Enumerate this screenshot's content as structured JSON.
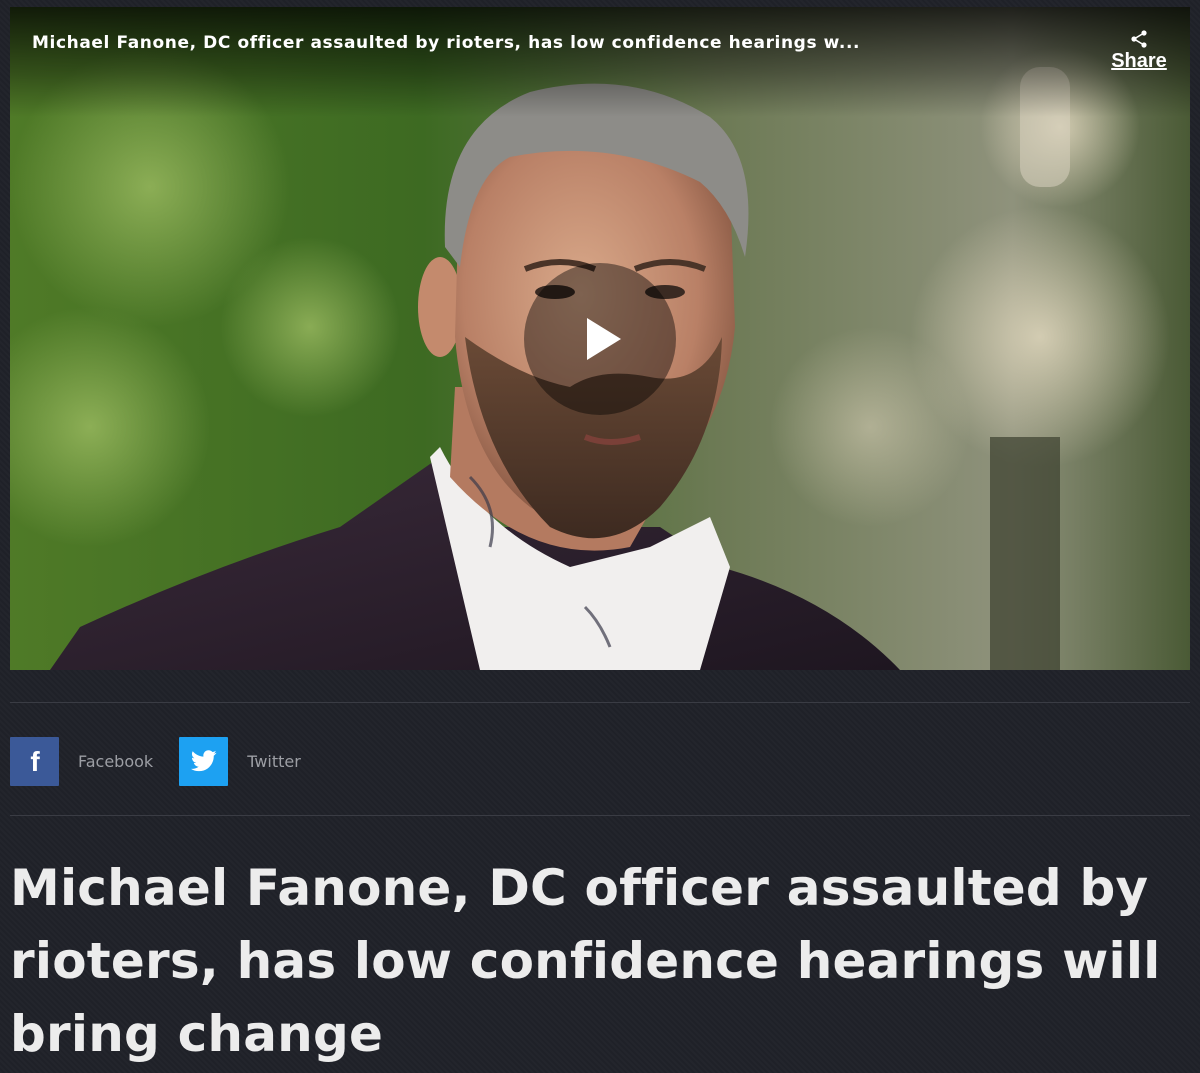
{
  "video": {
    "title": "Michael Fanone, DC officer assaulted by rioters, has low confidence hearings w...",
    "share_label": "Share",
    "share_icon": "share-icon",
    "play_icon": "play-icon"
  },
  "social": {
    "facebook": {
      "label": "Facebook",
      "icon": "facebook-icon",
      "color": "#3b5998"
    },
    "twitter": {
      "label": "Twitter",
      "icon": "twitter-icon",
      "color": "#1da1f2"
    }
  },
  "article": {
    "headline": "Michael Fanone, DC officer assaulted by rioters, has low confidence hearings will bring change"
  },
  "colors": {
    "background": "#1f2128",
    "text": "#ececec",
    "muted": "#9c9ea4"
  }
}
